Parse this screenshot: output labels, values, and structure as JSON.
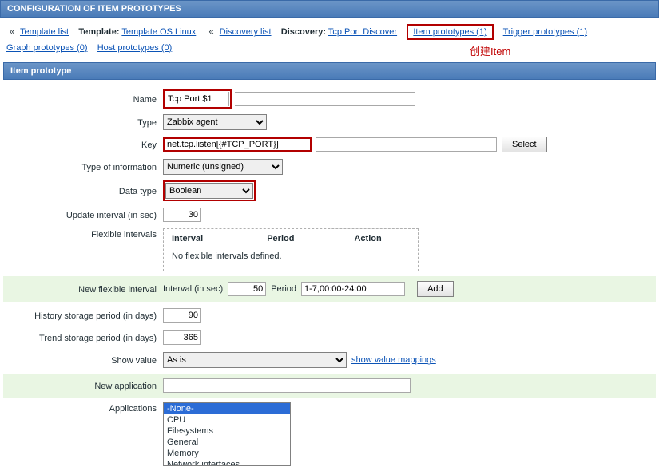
{
  "header": {
    "title": "CONFIGURATION OF ITEM PROTOTYPES"
  },
  "nav": {
    "dlm": "«",
    "template_list": "Template list",
    "template_label": "Template:",
    "template_link": "Template OS Linux",
    "discovery_list": "Discovery list",
    "discovery_label": "Discovery:",
    "discovery_link": "Tcp Port Discover",
    "item_proto": "Item prototypes (1)",
    "trigger_proto": "Trigger prototypes (1)",
    "graph_proto": "Graph prototypes (0)",
    "host_proto": "Host prototypes (0)"
  },
  "annot": "创建Item",
  "section": {
    "title": "Item prototype"
  },
  "form": {
    "name_label": "Name",
    "name_value": "Tcp Port $1",
    "type_label": "Type",
    "type_value": "Zabbix agent",
    "key_label": "Key",
    "key_value": "net.tcp.listen[{#TCP_PORT}]",
    "select_btn": "Select",
    "toi_label": "Type of information",
    "toi_value": "Numeric (unsigned)",
    "dt_label": "Data type",
    "dt_value": "Boolean",
    "upd_label": "Update interval (in sec)",
    "upd_value": "30",
    "flex_label": "Flexible intervals",
    "flex_hdr_interval": "Interval",
    "flex_hdr_period": "Period",
    "flex_hdr_action": "Action",
    "flex_empty": "No flexible intervals defined.",
    "new_flex_label": "New flexible interval",
    "new_flex_int_label": "Interval (in sec)",
    "new_flex_int_value": "50",
    "new_flex_period_label": "Period",
    "new_flex_period_value": "1-7,00:00-24:00",
    "add_btn": "Add",
    "hist_label": "History storage period (in days)",
    "hist_value": "90",
    "trend_label": "Trend storage period (in days)",
    "trend_value": "365",
    "showval_label": "Show value",
    "showval_value": "As is",
    "showval_link": "show value mappings",
    "newapp_label": "New application",
    "newapp_value": "",
    "apps_label": "Applications",
    "apps_options": [
      "-None-",
      "CPU",
      "Filesystems",
      "General",
      "Memory",
      "Network interfaces"
    ],
    "apps_selected": "-None-"
  }
}
